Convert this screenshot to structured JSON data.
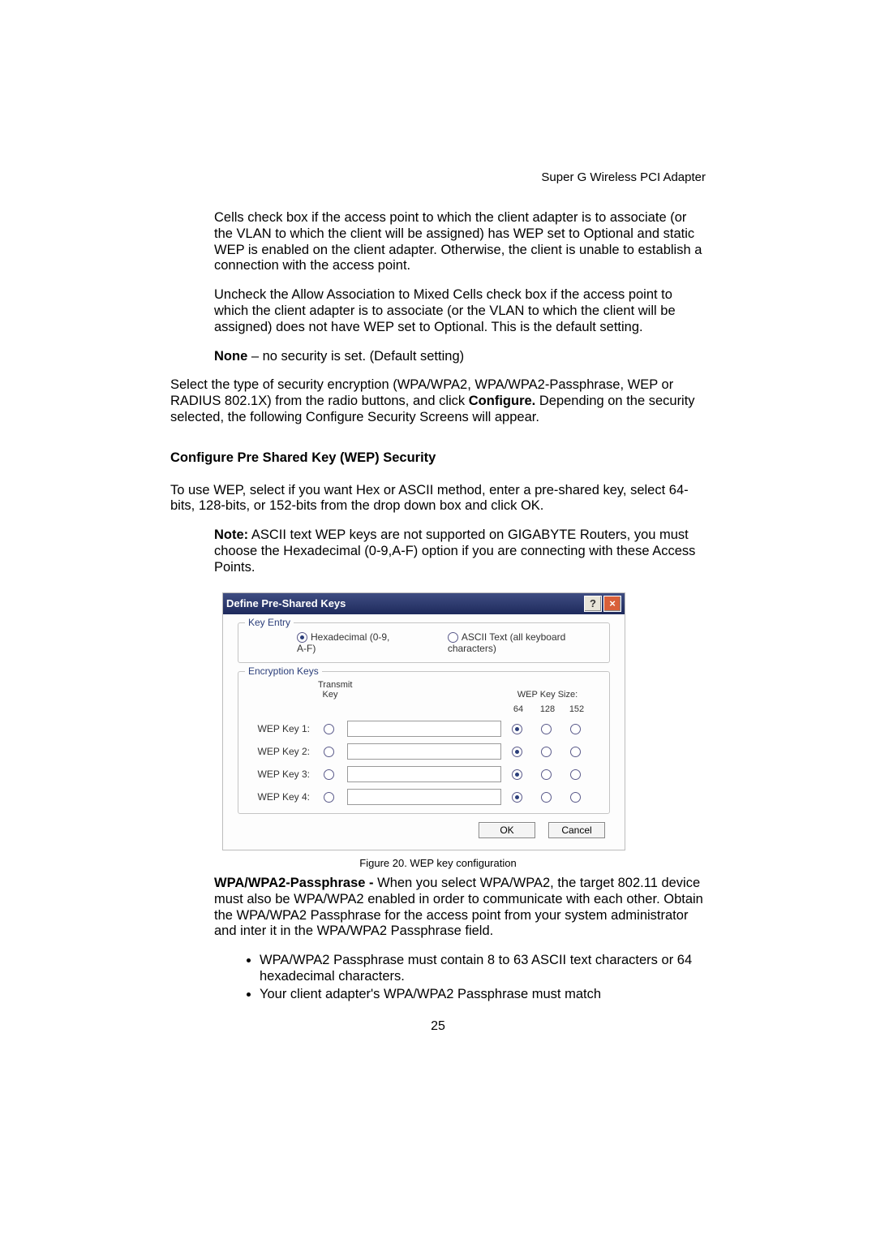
{
  "header": {
    "product": "Super G Wireless PCI Adapter"
  },
  "body": {
    "p1": "Cells check box if the access point to which the client adapter is to associate (or the VLAN to which the client will be assigned) has WEP set to Optional and static WEP is enabled on the client adapter. Otherwise, the client is unable to establish a connection with the access point.",
    "p2": "Uncheck the Allow Association to Mixed Cells check box if the access point to which the client adapter is to associate (or the VLAN to which the client will be assigned) does not have WEP set to Optional. This is the default setting.",
    "p3_bold": "None",
    "p3_rest": " – no security is set. (Default setting)",
    "p4a": "Select the type of security encryption (WPA/WPA2, WPA/WPA2-Passphrase, WEP or RADIUS 802.1X) from the radio buttons, and click ",
    "p4b_bold": "Configure.",
    "p4c": " Depending on the security selected, the following Configure Security Screens will appear.",
    "h_wep": "Configure Pre Shared Key (WEP) Security",
    "p5": "To use WEP, select if you want Hex or ASCII method, enter a pre-shared key, select 64-bits, 128-bits, or 152-bits from the drop down box and click OK.",
    "note_bold": "Note:",
    "note_rest": " ASCII text WEP keys are not supported on GIGABYTE Routers, you must choose the Hexadecimal (0-9,A-F) option if you are connecting with these Access Points.",
    "caption": "Figure 20. WEP key configuration",
    "p6_bold": "WPA/WPA2-Passphrase -",
    "p6_rest": " When you select WPA/WPA2, the target 802.11 device must also be WPA/WPA2 enabled in order to communicate with each other. Obtain the WPA/WPA2 Passphrase for the access point from your system administrator and inter it in the WPA/WPA2 Passphrase field.",
    "bullets": [
      "WPA/WPA2 Passphrase must contain 8 to 63 ASCII text characters or 64 hexadecimal characters.",
      "Your client adapter's WPA/WPA2 Passphrase must match"
    ],
    "page_number": "25"
  },
  "dialog": {
    "title": "Define Pre-Shared Keys",
    "group1_legend": "Key Entry",
    "radio_hex": "Hexadecimal (0-9, A-F)",
    "radio_ascii": "ASCII Text (all keyboard characters)",
    "group2_legend": "Encryption Keys",
    "transmit_label_1": "Transmit",
    "transmit_label_2": "Key",
    "size_header": "WEP Key Size:",
    "size_64": "64",
    "size_128": "128",
    "size_152": "152",
    "rows": [
      {
        "label": "WEP Key 1:"
      },
      {
        "label": "WEP Key 2:"
      },
      {
        "label": "WEP Key 3:"
      },
      {
        "label": "WEP Key 4:"
      }
    ],
    "ok": "OK",
    "cancel": "Cancel"
  }
}
